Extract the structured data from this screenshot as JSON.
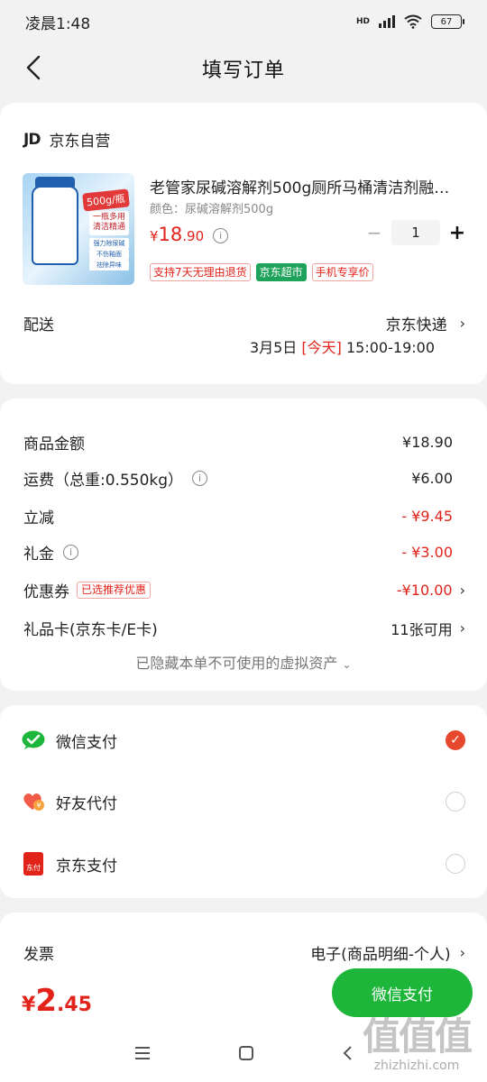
{
  "status": {
    "time": "凌晨1:48",
    "net_label": "HD",
    "battery": "67"
  },
  "header": {
    "title": "填写订单"
  },
  "shop": {
    "logo": "JD",
    "name": "京东自营"
  },
  "product": {
    "title": "老管家尿碱溶解剂500g厕所马桶清洁剂融…",
    "spec": "颜色：尿碱溶解剂500g",
    "price_symbol": "¥",
    "price_int": "18",
    "price_dec": ".90",
    "quantity": "1",
    "image_text": {
      "tag": "500g/瓶",
      "slogan": "一瓶多用 清洁精通",
      "features": [
        "强力除尿碱",
        "不伤釉面",
        "祛除异味"
      ]
    },
    "badges": [
      "支持7天无理由退货",
      "京东超市",
      "手机专享价"
    ]
  },
  "delivery": {
    "label": "配送",
    "carrier": "京东快递",
    "date": "3月5日",
    "today": "[今天]",
    "slot": "15:00-19:00"
  },
  "summary": {
    "goods": {
      "label": "商品金额",
      "value": "¥18.90"
    },
    "shipping": {
      "label": "运费（总重:0.550kg）",
      "value": "¥6.00"
    },
    "discount": {
      "label": "立减",
      "value": "- ¥9.45"
    },
    "gift": {
      "label": "礼金",
      "value": "- ¥3.00"
    },
    "coupon": {
      "label": "优惠券",
      "tag": "已选推荐优惠",
      "value": "-¥10.00"
    },
    "giftcard": {
      "label": "礼品卡(京东卡/E卡)",
      "value": "11张可用"
    },
    "hidden_note": "已隐藏本单不可使用的虚拟资产"
  },
  "payment": {
    "wechat": "微信支付",
    "friend": "好友代付",
    "jd": "京东支付",
    "jd_icon_text": "东付"
  },
  "invoice": {
    "label": "发票",
    "value": "电子(商品明细-个人)"
  },
  "total": {
    "symbol": "¥",
    "int": "2",
    "dec": ".45"
  },
  "submit": {
    "label": "微信支付"
  },
  "watermark": {
    "main": "值值值",
    "url": "zhizhizhi.com"
  },
  "colors": {
    "accent_red": "#e2231a",
    "wechat_green": "#1db63a",
    "jd_green": "#1fa35a"
  }
}
